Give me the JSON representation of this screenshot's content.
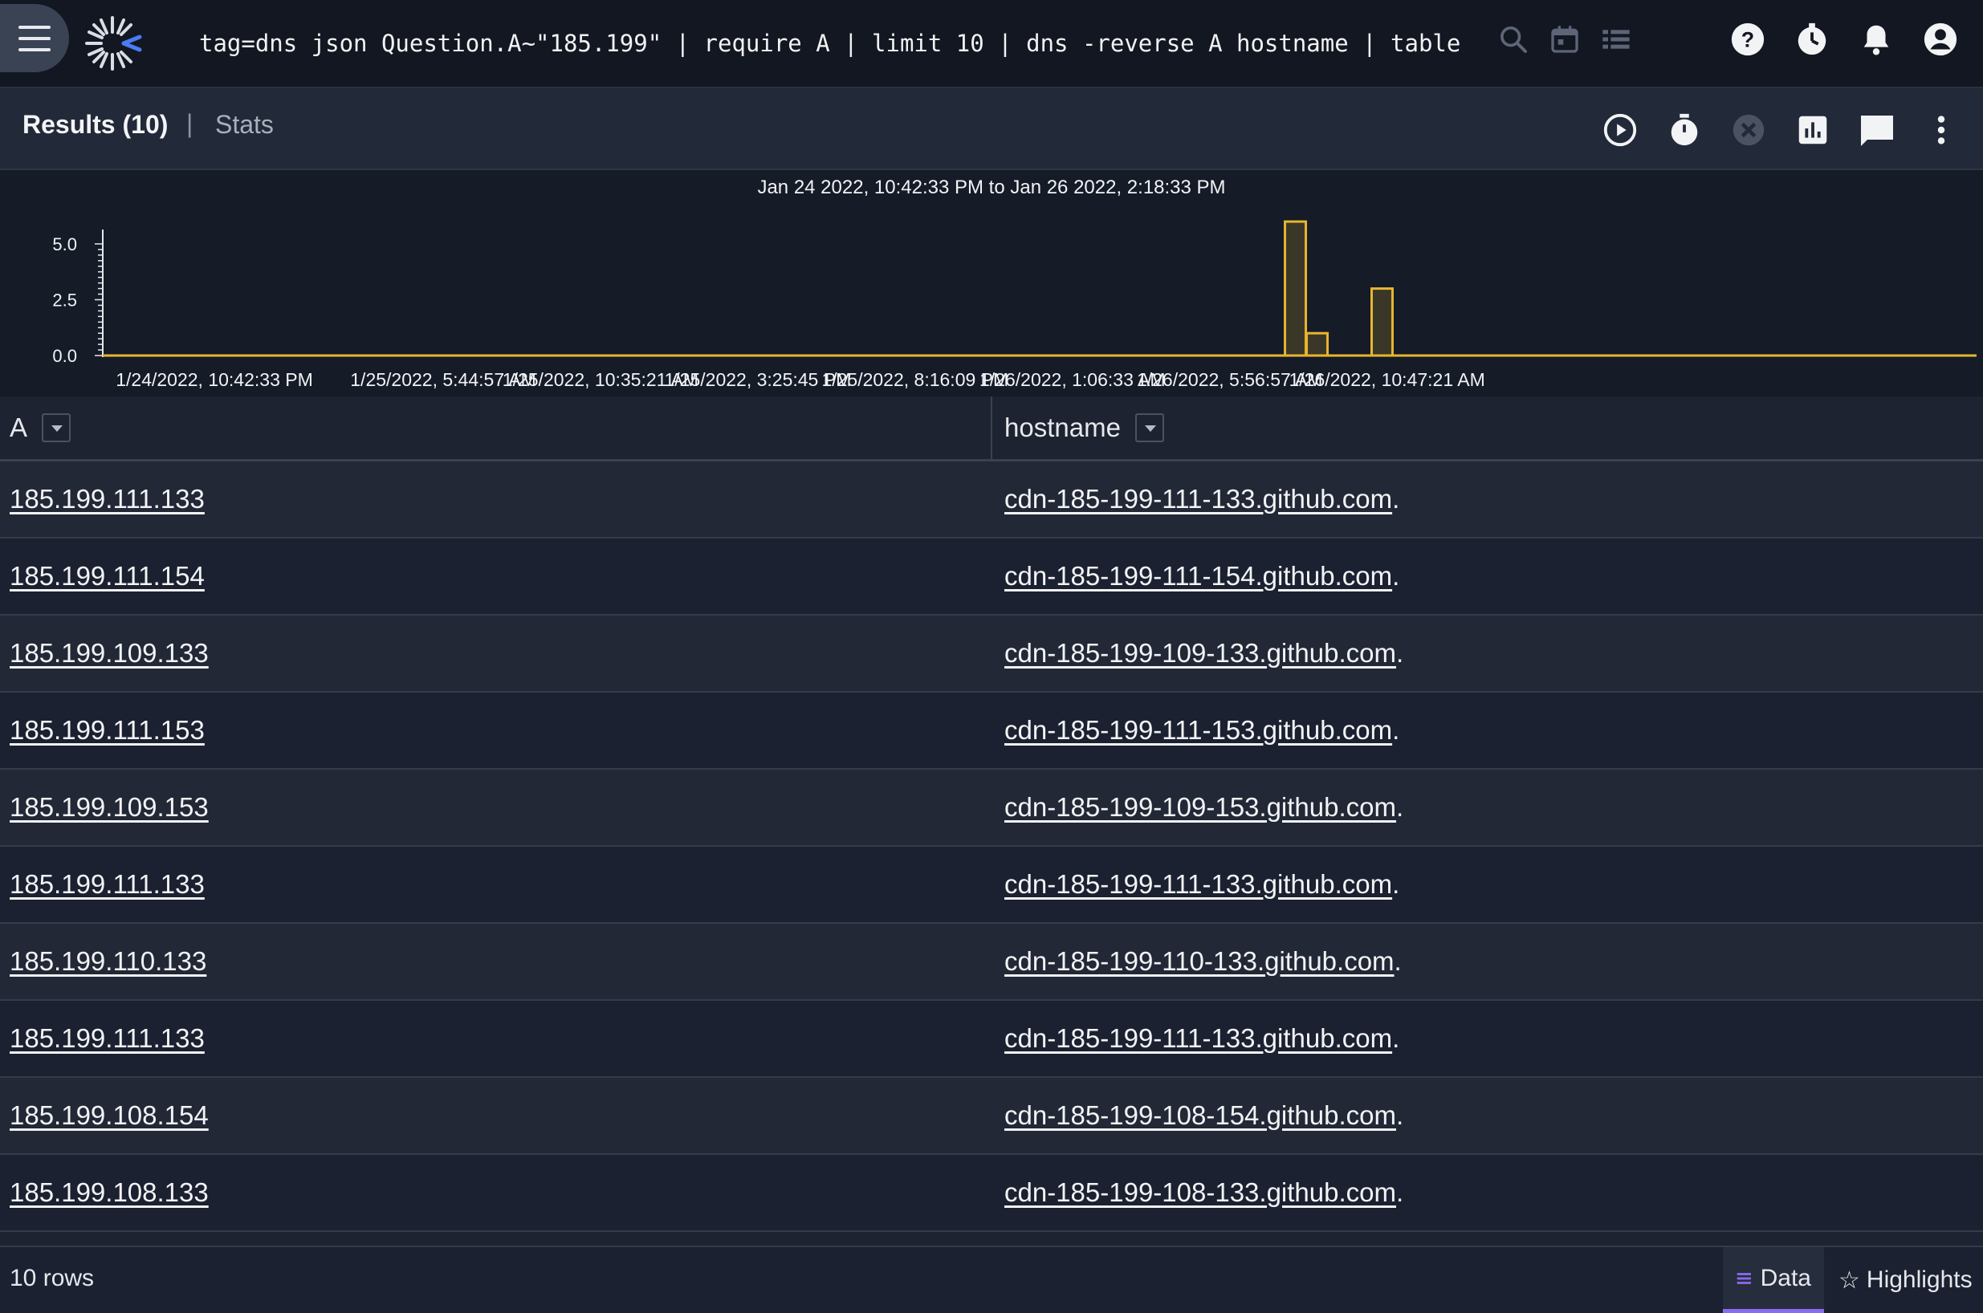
{
  "header": {
    "query": "tag=dns json Question.A~\"185.199\" | require A | limit 10 | dns -reverse A hostname | table",
    "icons": [
      "menu-icon",
      "logo-icon",
      "search-icon",
      "calendar-icon",
      "list-icon",
      "help-icon",
      "history-icon",
      "notifications-icon",
      "account-icon"
    ]
  },
  "toolbar": {
    "results_label": "Results (10)",
    "separator": "|",
    "stats_label": "Stats",
    "icons": [
      "run-icon",
      "timer-icon",
      "cancel-icon",
      "chart-icon",
      "comment-icon",
      "more-icon"
    ]
  },
  "chart_data": {
    "type": "bar",
    "title": "Jan 24 2022, 10:42:33 PM to Jan 26 2022, 2:18:33 PM",
    "xlabel": "",
    "ylabel": "",
    "x_tick_labels": [
      "1/24/2022, 10:42:33 PM",
      "1/25/2022, 5:44:57 AM",
      "1/25/2022, 10:35:21 AM",
      "1/25/2022, 3:25:45 PM",
      "1/25/2022, 8:16:09 PM",
      "1/26/2022, 1:06:33 AM",
      "1/26/2022, 5:56:57 AM",
      "1/26/2022, 10:47:21 AM"
    ],
    "y_tick_labels": [
      "5.0",
      "2.5",
      "0.0"
    ],
    "ylim": [
      0,
      5.5
    ],
    "bars": [
      {
        "x": "1/26/2022, 11:05:00 AM",
        "value": 6
      },
      {
        "x": "1/26/2022, 11:45:00 AM",
        "value": 1
      },
      {
        "x": "1/26/2022, 1:45:00 PM",
        "value": 3
      }
    ],
    "color": "#e8b530",
    "grid": false
  },
  "table": {
    "columns": [
      {
        "label": "A"
      },
      {
        "label": "hostname"
      }
    ],
    "rows": [
      {
        "a": "185.199.111.133",
        "hostname": "cdn-185-199-111-133.github.com",
        "suffix": "."
      },
      {
        "a": "185.199.111.154",
        "hostname": "cdn-185-199-111-154.github.com",
        "suffix": "."
      },
      {
        "a": "185.199.109.133",
        "hostname": "cdn-185-199-109-133.github.com",
        "suffix": "."
      },
      {
        "a": "185.199.111.153",
        "hostname": "cdn-185-199-111-153.github.com",
        "suffix": "."
      },
      {
        "a": "185.199.109.153",
        "hostname": "cdn-185-199-109-153.github.com",
        "suffix": "."
      },
      {
        "a": "185.199.111.133",
        "hostname": "cdn-185-199-111-133.github.com",
        "suffix": "."
      },
      {
        "a": "185.199.110.133",
        "hostname": "cdn-185-199-110-133.github.com",
        "suffix": "."
      },
      {
        "a": "185.199.111.133",
        "hostname": "cdn-185-199-111-133.github.com",
        "suffix": "."
      },
      {
        "a": "185.199.108.154",
        "hostname": "cdn-185-199-108-154.github.com",
        "suffix": "."
      },
      {
        "a": "185.199.108.133",
        "hostname": "cdn-185-199-108-133.github.com",
        "suffix": "."
      }
    ]
  },
  "footer": {
    "row_count": "10 rows",
    "data_tab": "Data",
    "highlights_tab": "Highlights"
  },
  "colors": {
    "accent": "#8a6cf0",
    "bar": "#e8b530",
    "background": "#1d2331"
  }
}
